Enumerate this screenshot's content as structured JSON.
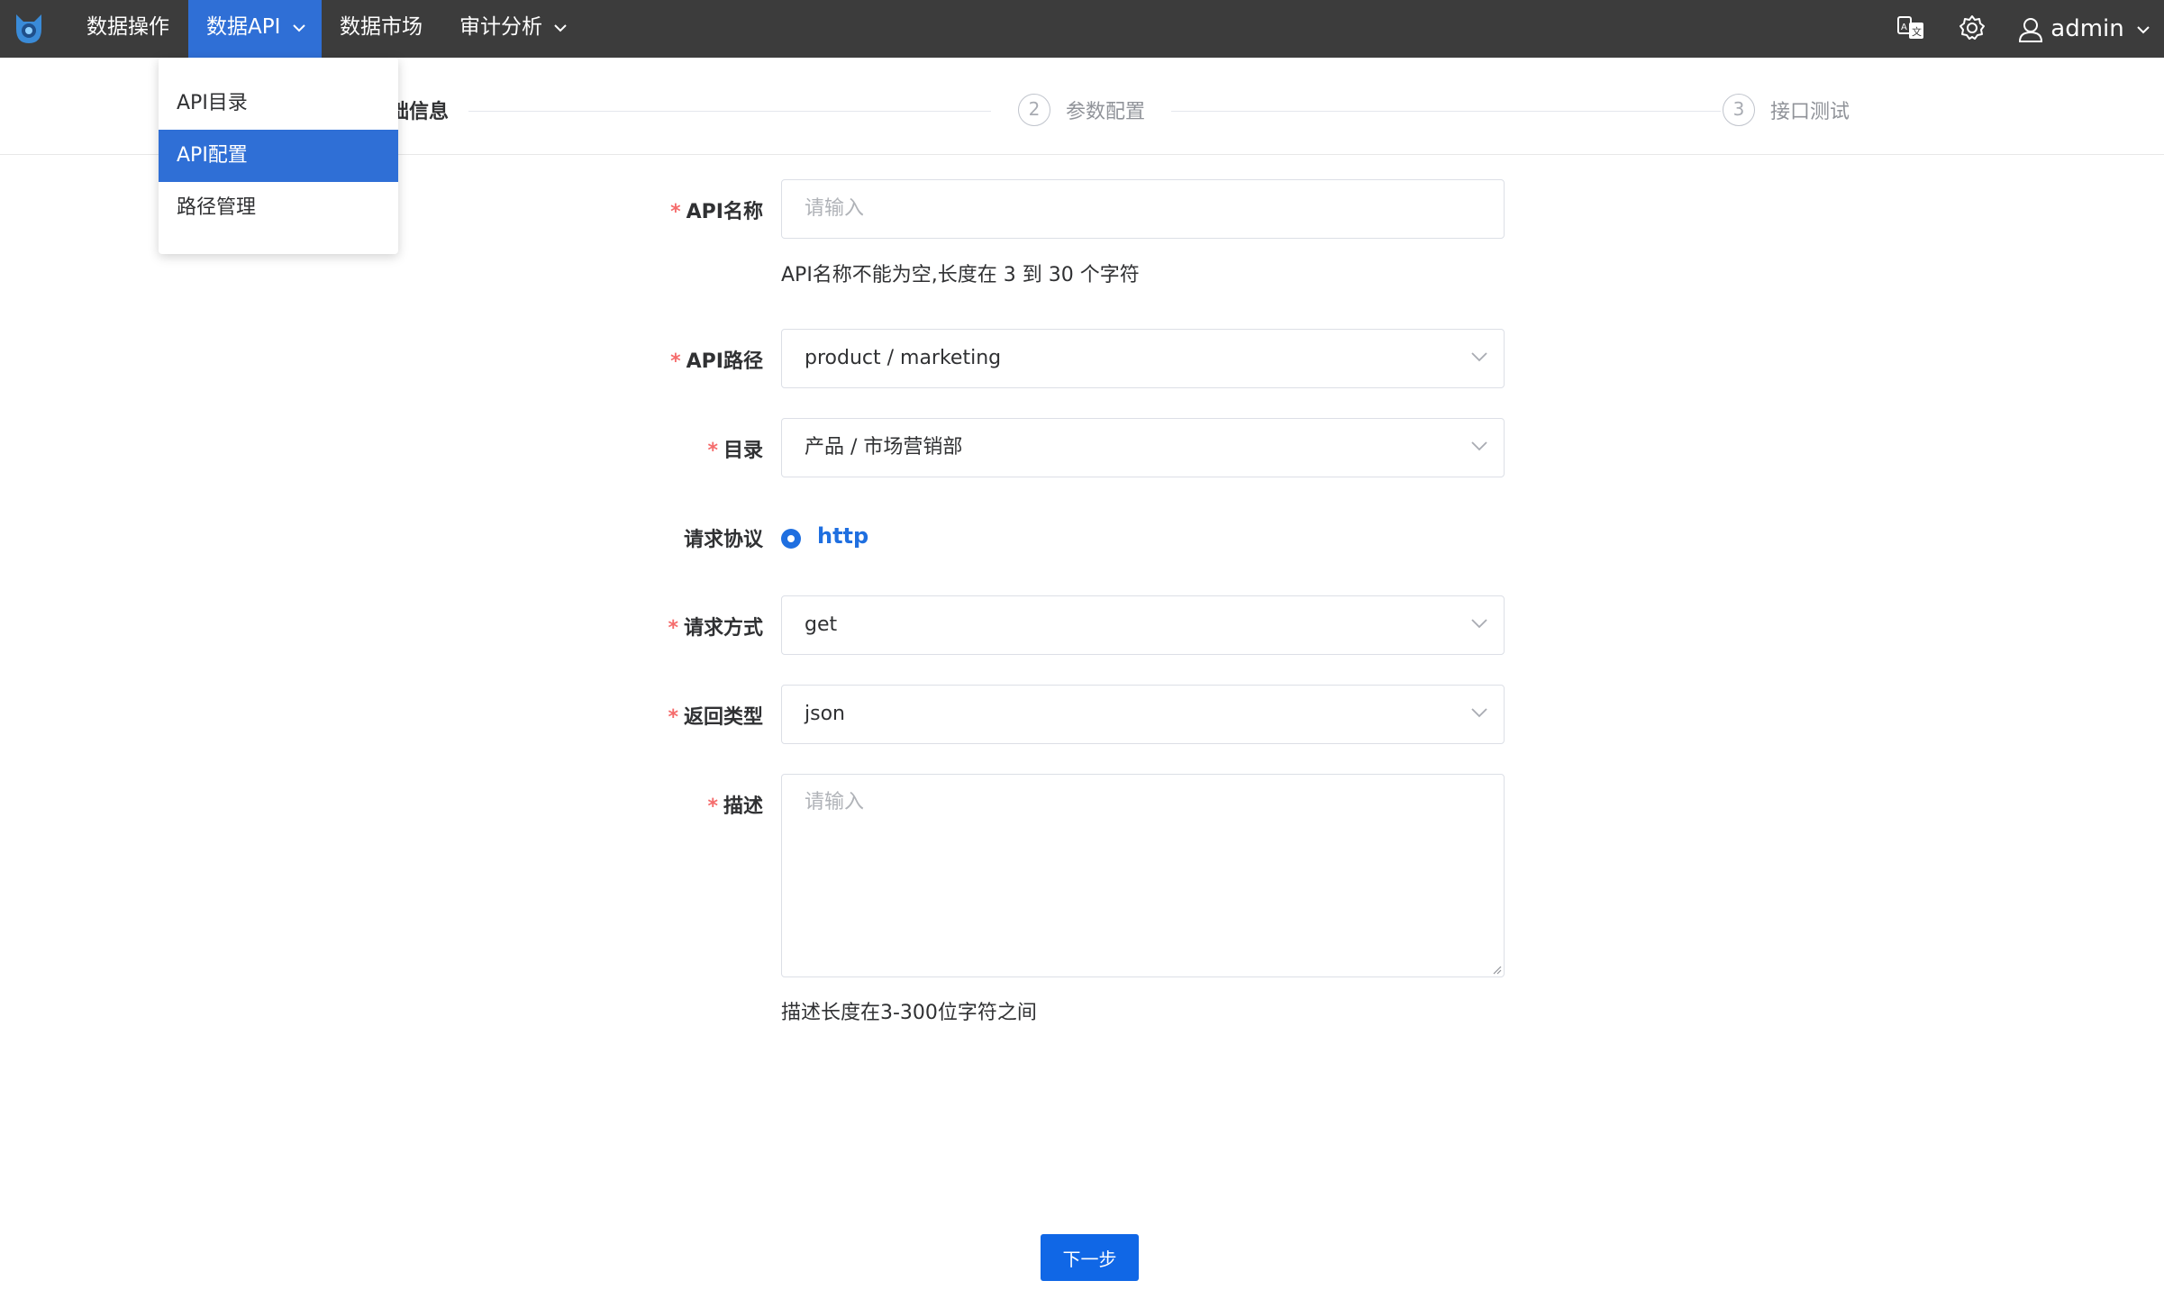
{
  "nav": {
    "items": [
      "数据操作",
      "数据API",
      "数据市场",
      "审计分析"
    ],
    "user": "admin"
  },
  "dropdown": {
    "items": [
      "API目录",
      "API配置",
      "路径管理"
    ]
  },
  "steps": {
    "step1_title": "础信息",
    "step2_num": "2",
    "step2_title": "参数配置",
    "step3_num": "3",
    "step3_title": "接口测试"
  },
  "form": {
    "required_mark": "*",
    "name_label": "API名称",
    "name_placeholder": "请输入",
    "name_hint": "API名称不能为空,长度在 3 到 30 个字符",
    "path_label": "API路径",
    "path_value": "product / marketing",
    "catalog_label": "目录",
    "catalog_value": "产品 / 市场营销部",
    "protocol_label": "请求协议",
    "protocol_value": "http",
    "method_label": "请求方式",
    "method_value": "get",
    "return_label": "返回类型",
    "return_value": "json",
    "desc_label": "描述",
    "desc_placeholder": "请输入",
    "desc_hint": "描述长度在3-300位字符之间"
  },
  "buttons": {
    "next": "下一步"
  },
  "colors": {
    "topbar": "#3c3c3c",
    "active": "#2f6fd6",
    "primary": "#1067e6",
    "required": "#f56c6c"
  }
}
